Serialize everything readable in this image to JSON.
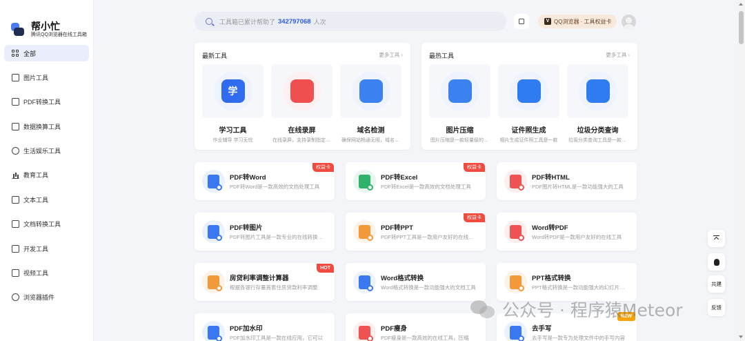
{
  "brand": {
    "title": "帮小忙",
    "subtitle": "腾讯QQ浏览器在线工具箱"
  },
  "sidebar": {
    "items": [
      {
        "label": "全部",
        "icon": "grid-icon",
        "active": true
      },
      {
        "label": "图片工具",
        "icon": "image-icon"
      },
      {
        "label": "PDF转换工具",
        "icon": "pdf-icon"
      },
      {
        "label": "数据换算工具",
        "icon": "calculator-icon"
      },
      {
        "label": "生活娱乐工具",
        "icon": "life-icon"
      },
      {
        "label": "教育工具",
        "icon": "education-icon"
      },
      {
        "label": "文本工具",
        "icon": "text-icon"
      },
      {
        "label": "文档转换工具",
        "icon": "document-icon"
      },
      {
        "label": "开发工具",
        "icon": "code-icon"
      },
      {
        "label": "视频工具",
        "icon": "video-icon"
      },
      {
        "label": "浏览器插件",
        "icon": "plugin-icon"
      }
    ]
  },
  "search": {
    "prefix": "工具箱已累计帮助了",
    "count": "342797068",
    "suffix": "人次"
  },
  "header": {
    "vip_label": "QQ浏览器 · 工具权益卡",
    "vip_icon_text": "V"
  },
  "latest": {
    "title": "最新工具",
    "more": "更多工具 ›",
    "items": [
      {
        "name": "学习工具",
        "desc": "作业辅导 学习无忧",
        "color": "#2f6cf0",
        "bg": "#eef3fd",
        "glyph": "学"
      },
      {
        "name": "在线录屏",
        "desc": "在线录屏，支持录制指定窗口",
        "color": "#f04f4f",
        "bg": "#fdf0f0",
        "glyph": ""
      },
      {
        "name": "域名检测",
        "desc": "确保网站畅通无阻，域名检测",
        "color": "#3b82f0",
        "bg": "#eef3fd",
        "glyph": ""
      }
    ]
  },
  "hottest": {
    "title": "最热工具",
    "more": "更多工具 ›",
    "items": [
      {
        "name": "图片压缩",
        "desc": "图片压缩是一款轻量级的在线工具",
        "color": "#3b82f0",
        "bg": "#eef3fd",
        "glyph": ""
      },
      {
        "name": "证件照生成",
        "desc": "相片生成证件照工具是一款",
        "color": "#2f7cf0",
        "bg": "#eef3fd",
        "glyph": ""
      },
      {
        "name": "垃圾分类查询",
        "desc": "垃圾分类查询工具是一款在线工具",
        "color": "#2f7cf0",
        "bg": "#eef3fd",
        "glyph": ""
      }
    ]
  },
  "tools": [
    {
      "name": "PDF转Word",
      "desc": "PDF转Word是一款高效的文档处理工具",
      "color": "#3a78f2",
      "bg": "#e9f0fe",
      "badge": "权益卡",
      "badge_type": "quan"
    },
    {
      "name": "PDF转Excel",
      "desc": "PDF转Excel是一款高效的文档处理工具",
      "color": "#2fb26b",
      "bg": "#e7f6ee",
      "badge": "权益卡",
      "badge_type": "quan"
    },
    {
      "name": "PDF转HTML",
      "desc": "PDF图片转HTML是一款功能强大的工具",
      "color": "#ee5252",
      "bg": "#fdeeee",
      "badge": "",
      "badge_type": ""
    },
    {
      "name": "PDF转图片",
      "desc": "PDF转图片工具是一款专业的在线转换工具",
      "color": "#3a78f2",
      "bg": "#e9f0fe",
      "badge": "",
      "badge_type": ""
    },
    {
      "name": "PDF转PPT",
      "desc": "PDF转PPT工具是一款用户友好的在线工具",
      "color": "#f29a3a",
      "bg": "#fdf2e6",
      "badge": "权益卡",
      "badge_type": "quan"
    },
    {
      "name": "Word转PDF",
      "desc": "Word转PDF是一款用户友好的在线工具",
      "color": "#ee5252",
      "bg": "#fdeeee",
      "badge": "",
      "badge_type": ""
    },
    {
      "name": "房贷利率调整计算器",
      "desc": "根据各银行存量首套住房贷款利率调整",
      "color": "#f29a3a",
      "bg": "#fdf2e6",
      "badge": "HOT",
      "badge_type": "hot"
    },
    {
      "name": "Word格式转换",
      "desc": "Word格式转换是一款功能强大的文档工具",
      "color": "#3a78f2",
      "bg": "#eef3fb",
      "badge": "",
      "badge_type": ""
    },
    {
      "name": "PPT格式转换",
      "desc": "PPT格式转换是一款功能强大的幻灯片工具",
      "color": "#f29a3a",
      "bg": "#fdf2e6",
      "badge": "",
      "badge_type": ""
    },
    {
      "name": "PDF加水印",
      "desc": "PDF加水印工具是一款在线应用，它可以",
      "color": "#3a78f2",
      "bg": "#e9f0fe",
      "badge": "",
      "badge_type": ""
    },
    {
      "name": "PDF瘦身",
      "desc": "PDF瘦身是一款高效的在线工具，压缩",
      "color": "#ee5252",
      "bg": "#fdeeee",
      "badge": "",
      "badge_type": ""
    },
    {
      "name": "去手写",
      "desc": "去手写是一款专为处理文件中的手写内容",
      "color": "#3a78f2",
      "bg": "#e9f0fe",
      "badge": "NEW",
      "badge_type": "new"
    }
  ],
  "float": {
    "share": "共建",
    "feedback": "反馈"
  },
  "watermark": "公众号 · 程序猿Meteor"
}
